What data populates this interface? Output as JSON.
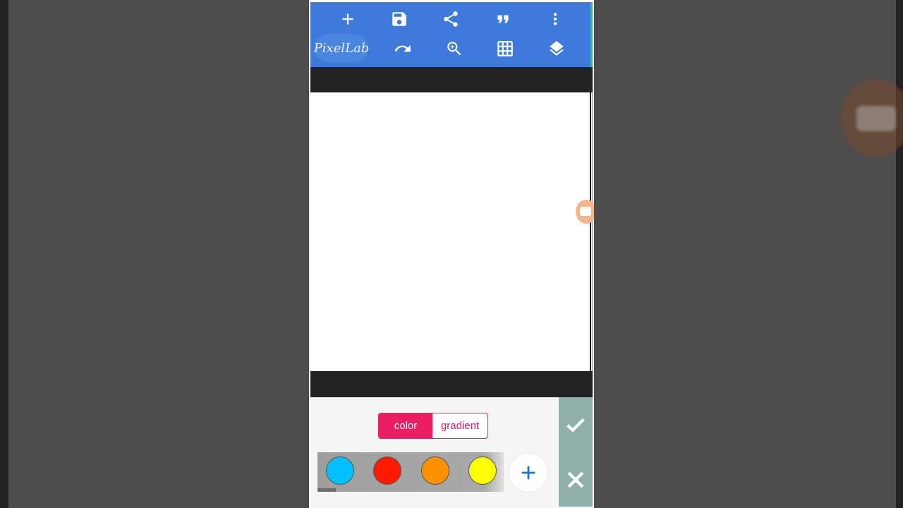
{
  "app": {
    "logo_text": "PixelLab"
  },
  "toolbar": {
    "row1": [
      {
        "name": "add-icon"
      },
      {
        "name": "save-icon"
      },
      {
        "name": "share-icon"
      },
      {
        "name": "quote-icon"
      },
      {
        "name": "more-vert-icon"
      }
    ],
    "row2": [
      {
        "name": "undo-icon"
      },
      {
        "name": "zoom-in-icon"
      },
      {
        "name": "grid-icon"
      },
      {
        "name": "layers-icon"
      }
    ],
    "color": "#3d7adb"
  },
  "fill_mode": {
    "color_label": "color",
    "gradient_label": "gradient",
    "selected": "color",
    "accent": "#e91e63"
  },
  "swatches": [
    {
      "name": "cyan",
      "color": "#00bfff"
    },
    {
      "name": "red",
      "color": "#ff1a00"
    },
    {
      "name": "orange",
      "color": "#ff9000"
    },
    {
      "name": "yellow",
      "color": "#ffff00"
    }
  ],
  "add_color_icon": "plus-icon",
  "confirm_icon": "check-icon",
  "cancel_icon": "close-icon"
}
